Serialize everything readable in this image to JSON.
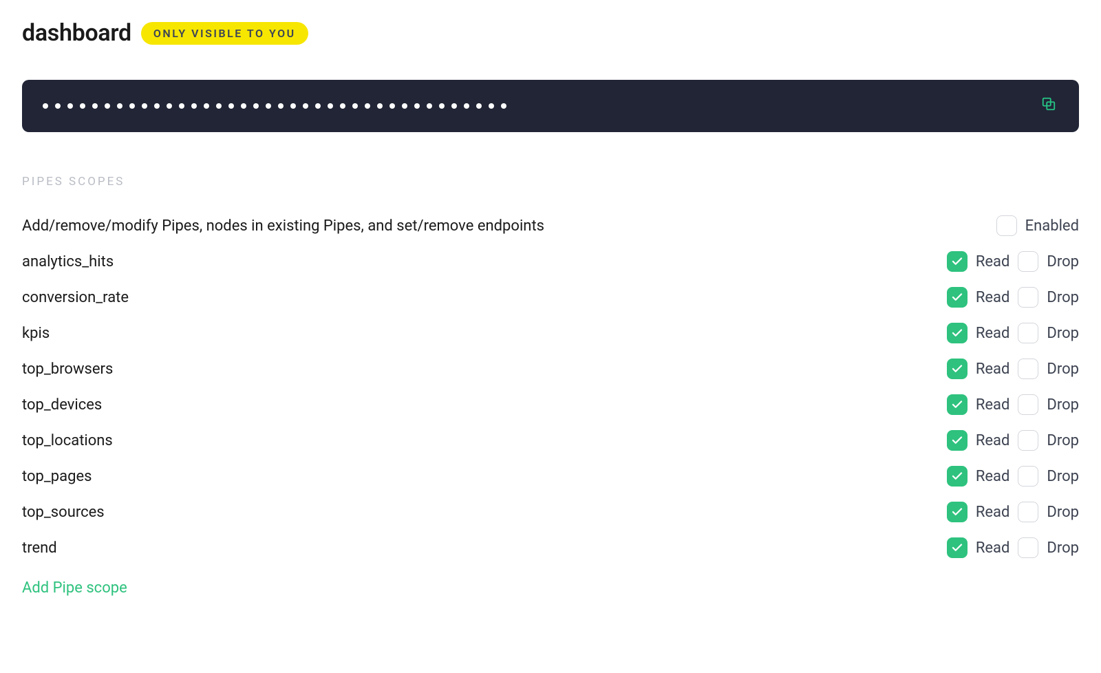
{
  "header": {
    "title": "dashboard",
    "badge": "ONLY VISIBLE TO YOU"
  },
  "token": {
    "masked_dot_count": 38
  },
  "section_label": "PIPES SCOPES",
  "scopes_description": {
    "text": "Add/remove/modify Pipes, nodes in existing Pipes, and set/remove endpoints",
    "enabled_label": "Enabled",
    "enabled": false
  },
  "labels": {
    "read": "Read",
    "drop": "Drop"
  },
  "pipes": [
    {
      "name": "analytics_hits",
      "read": true,
      "drop": false
    },
    {
      "name": "conversion_rate",
      "read": true,
      "drop": false
    },
    {
      "name": "kpis",
      "read": true,
      "drop": false
    },
    {
      "name": "top_browsers",
      "read": true,
      "drop": false
    },
    {
      "name": "top_devices",
      "read": true,
      "drop": false
    },
    {
      "name": "top_locations",
      "read": true,
      "drop": false
    },
    {
      "name": "top_pages",
      "read": true,
      "drop": false
    },
    {
      "name": "top_sources",
      "read": true,
      "drop": false
    },
    {
      "name": "trend",
      "read": true,
      "drop": false
    }
  ],
  "add_scope_label": "Add Pipe scope"
}
